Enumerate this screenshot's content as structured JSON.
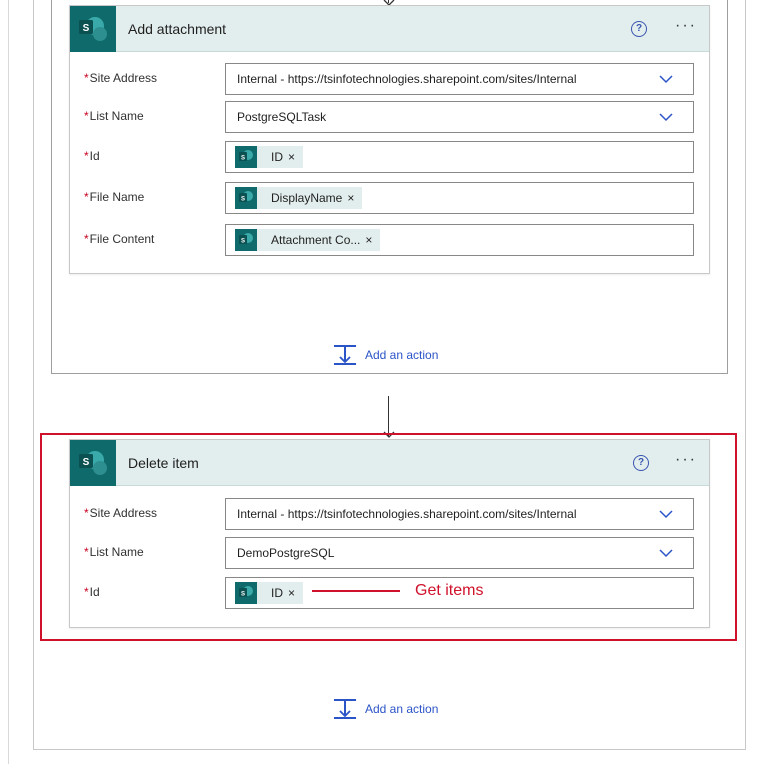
{
  "flow": {
    "add_action_label": "Add an action",
    "add_attachment": {
      "title": "Add attachment",
      "help_icon": "?",
      "more_icon": "···",
      "fields": {
        "site_address": {
          "required_mark": "*",
          "label": "Site Address",
          "value": "Internal - https://tsinfotechnologies.sharepoint.com/sites/Internal"
        },
        "list_name": {
          "required_mark": "*",
          "label": "List Name",
          "value": "PostgreSQLTask"
        },
        "id": {
          "required_mark": "*",
          "label": "Id",
          "token": "ID",
          "token_remove": "×"
        },
        "file_name": {
          "required_mark": "*",
          "label": "File Name",
          "token": "DisplayName",
          "token_remove": "×"
        },
        "file_content": {
          "required_mark": "*",
          "label": "File Content",
          "token": "Attachment Co...",
          "token_remove": "×"
        }
      }
    },
    "delete_item": {
      "title": "Delete item",
      "help_icon": "?",
      "more_icon": "···",
      "fields": {
        "site_address": {
          "required_mark": "*",
          "label": "Site Address",
          "value": "Internal - https://tsinfotechnologies.sharepoint.com/sites/Internal"
        },
        "list_name": {
          "required_mark": "*",
          "label": "List Name",
          "value": "DemoPostgreSQL"
        },
        "id": {
          "required_mark": "*",
          "label": "Id",
          "token": "ID",
          "token_remove": "×"
        }
      }
    },
    "annotation": "Get items"
  },
  "icons": {
    "connector": "sharepoint-logo-icon",
    "help": "help-circle-icon",
    "more": "more-dots-icon",
    "dropdown": "chevron-down-icon",
    "add_action": "add-action-icon"
  },
  "colors": {
    "sharepoint_teal": "#0f6b6b",
    "card_header": "#e2eeee",
    "link_blue": "#2b54c7",
    "required_red": "#c7001e",
    "annotation_red": "#d0112b"
  }
}
